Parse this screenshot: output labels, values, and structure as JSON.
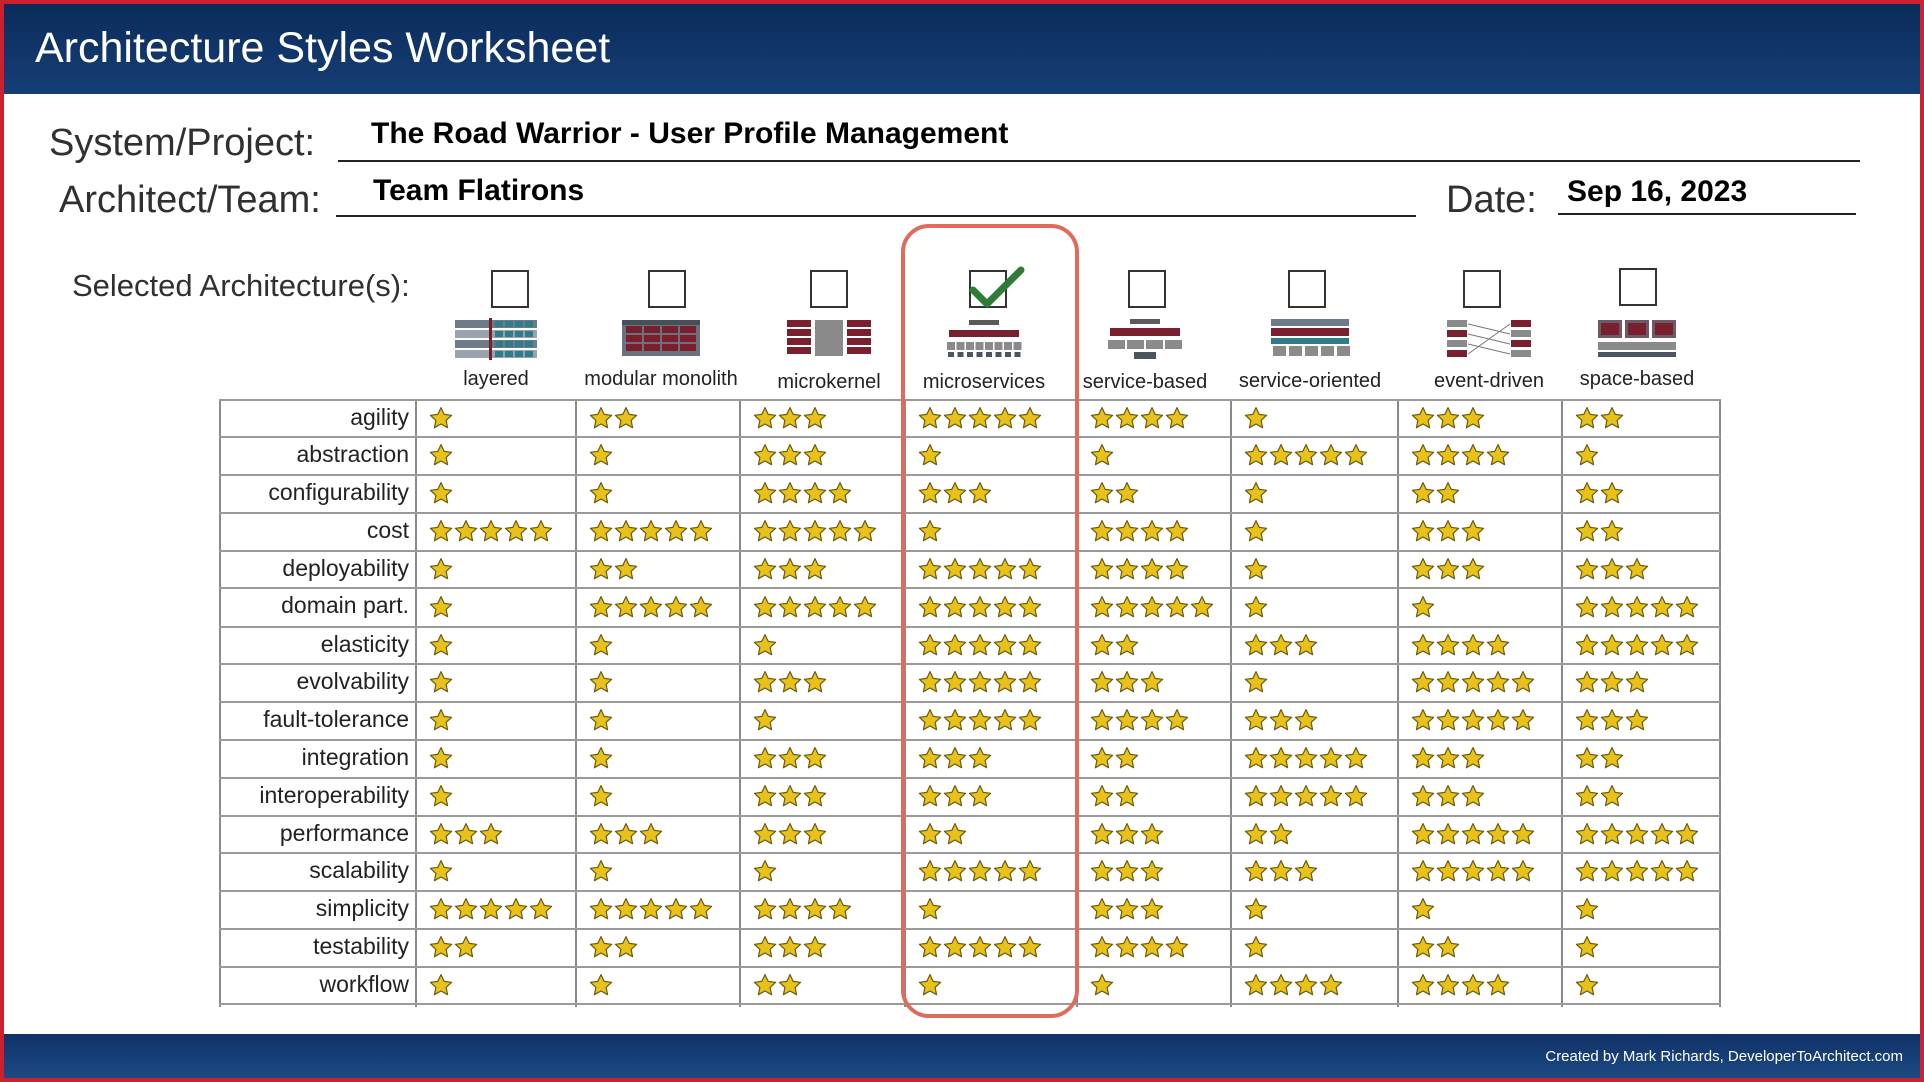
{
  "title": "Architecture Styles Worksheet",
  "form": {
    "system_label": "System/Project:",
    "system_value": "The Road Warrior -  User Profile Management",
    "architect_label": "Architect/Team:",
    "architect_value": "Team Flatirons",
    "date_label": "Date:",
    "date_value": "Sep 16, 2023"
  },
  "selected_label": "Selected Architecture(s):",
  "architectures": [
    {
      "name": "layered",
      "checked": false
    },
    {
      "name": "modular monolith",
      "checked": false
    },
    {
      "name": "microkernel",
      "checked": false
    },
    {
      "name": "microservices",
      "checked": true
    },
    {
      "name": "service-based",
      "checked": false
    },
    {
      "name": "service-oriented",
      "checked": false
    },
    {
      "name": "event-driven",
      "checked": false
    },
    {
      "name": "space-based",
      "checked": false
    }
  ],
  "criteria": [
    "agility",
    "abstraction",
    "configurability",
    "cost",
    "deployability",
    "domain part.",
    "elasticity",
    "evolvability",
    "fault-tolerance",
    "integration",
    "interoperability",
    "performance",
    "scalability",
    "simplicity",
    "testability",
    "workflow"
  ],
  "ratings": [
    [
      1,
      2,
      3,
      5,
      4,
      1,
      3,
      2
    ],
    [
      1,
      1,
      3,
      1,
      1,
      5,
      4,
      1
    ],
    [
      1,
      1,
      4,
      3,
      2,
      1,
      2,
      2
    ],
    [
      5,
      5,
      5,
      1,
      4,
      1,
      3,
      2
    ],
    [
      1,
      2,
      3,
      5,
      4,
      1,
      3,
      3
    ],
    [
      1,
      5,
      5,
      5,
      5,
      1,
      1,
      5
    ],
    [
      1,
      1,
      1,
      5,
      2,
      3,
      4,
      5
    ],
    [
      1,
      1,
      3,
      5,
      3,
      1,
      5,
      3
    ],
    [
      1,
      1,
      1,
      5,
      4,
      3,
      5,
      3
    ],
    [
      1,
      1,
      3,
      3,
      2,
      5,
      3,
      2
    ],
    [
      1,
      1,
      3,
      3,
      2,
      5,
      3,
      2
    ],
    [
      3,
      3,
      3,
      2,
      3,
      2,
      5,
      5
    ],
    [
      1,
      1,
      1,
      5,
      3,
      3,
      5,
      5
    ],
    [
      5,
      5,
      4,
      1,
      3,
      1,
      1,
      1
    ],
    [
      2,
      2,
      3,
      5,
      4,
      1,
      2,
      1
    ],
    [
      1,
      1,
      2,
      1,
      1,
      4,
      4,
      1
    ]
  ],
  "footer": "Created by Mark Richards, DeveloperToArchitect.com",
  "colors": {
    "header": "#123a70",
    "frame": "#cc2030",
    "highlight": "#e06b5c",
    "star_fill": "#e8c21a",
    "check": "#2f7d32"
  }
}
